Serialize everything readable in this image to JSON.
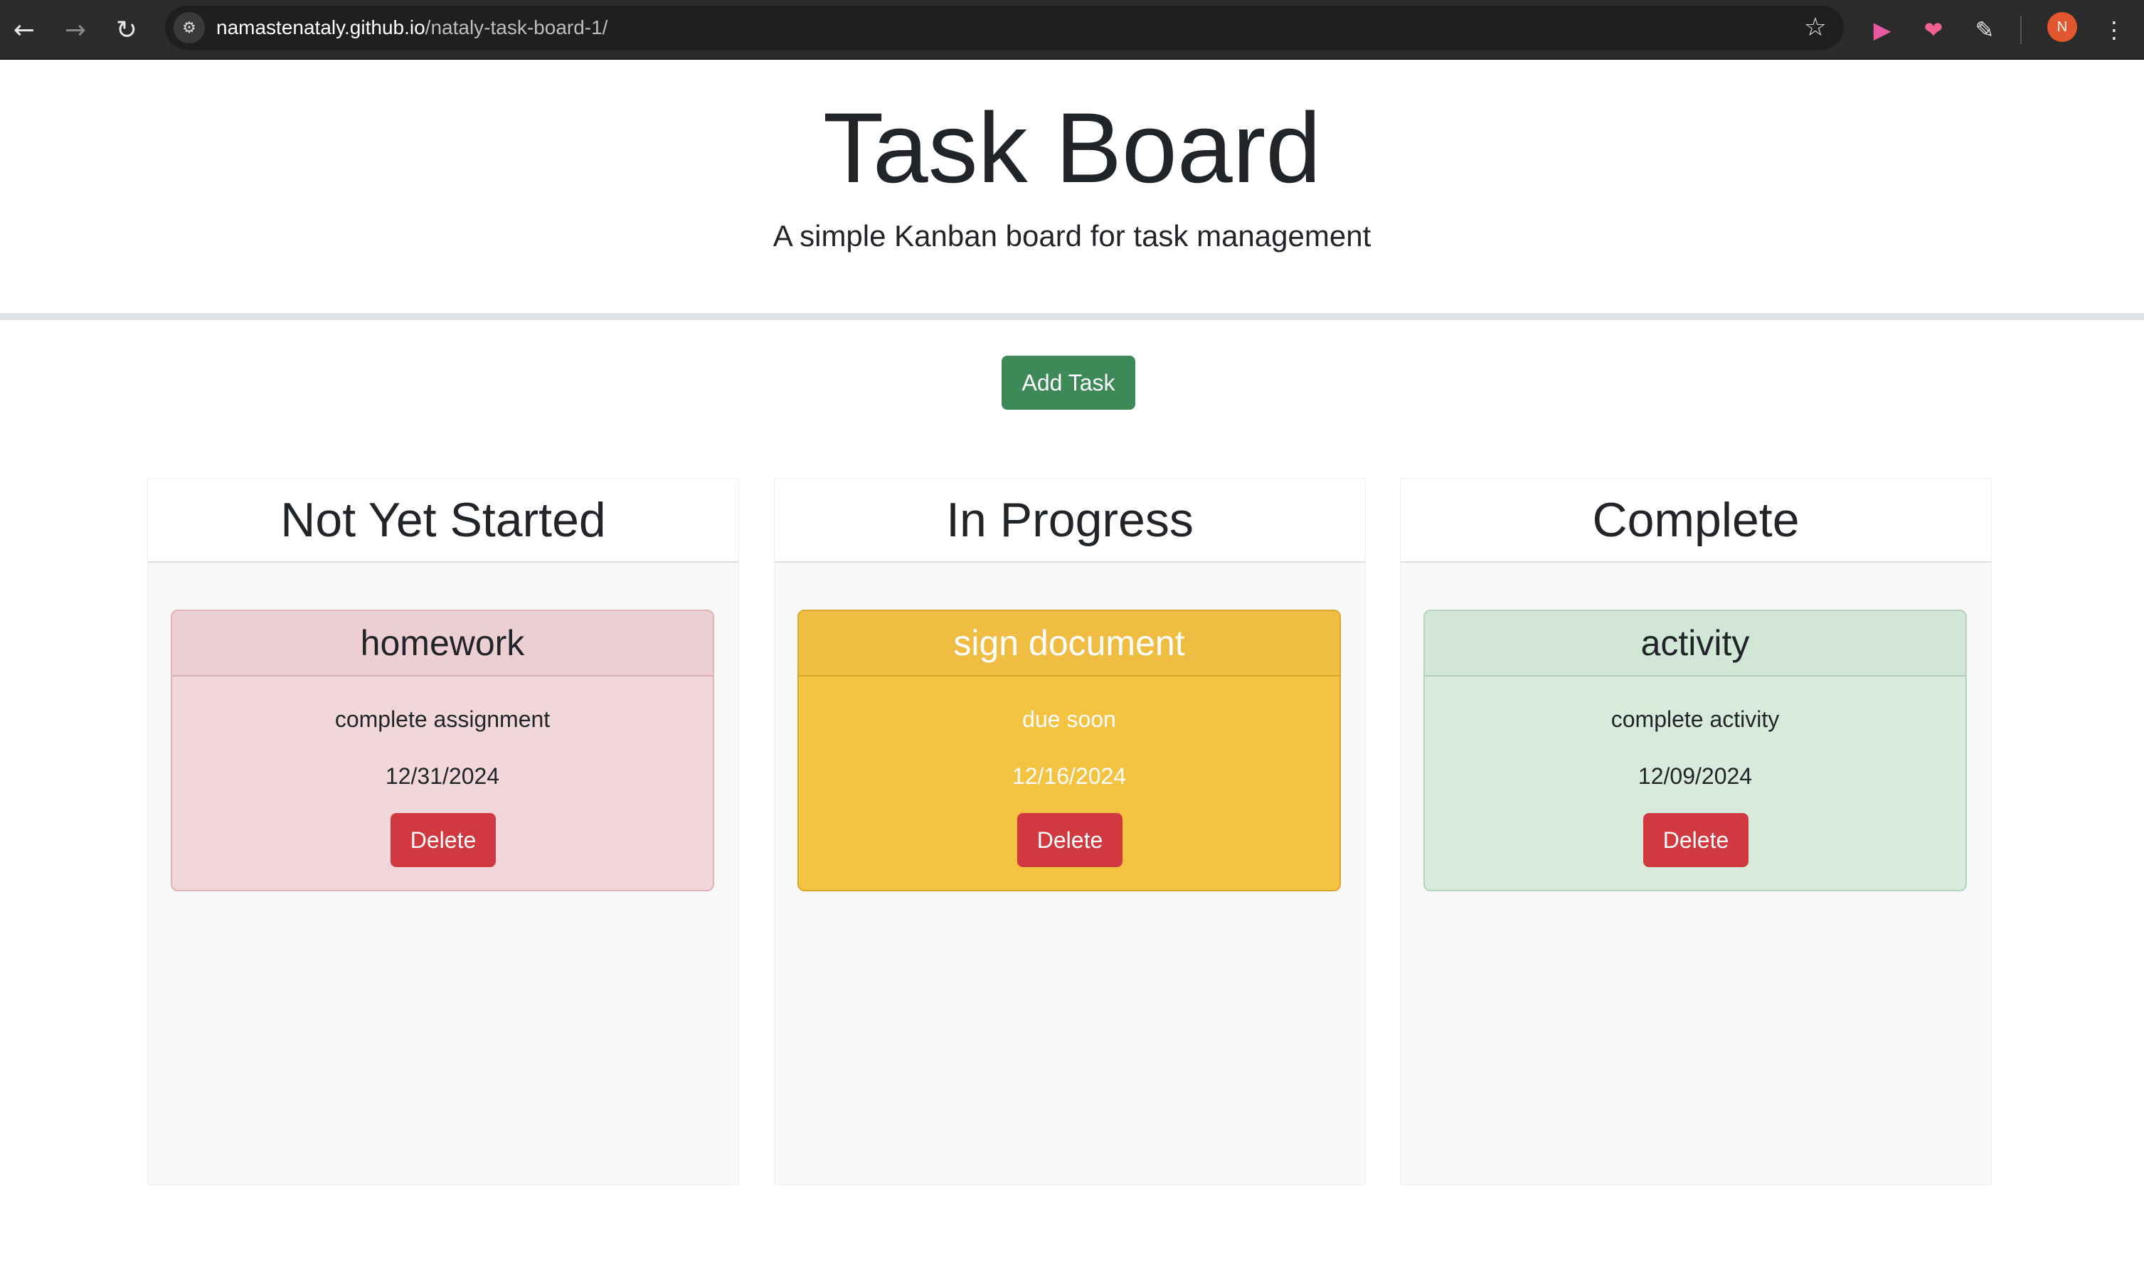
{
  "browser": {
    "url_host": "namastenataly.github.io",
    "url_path": "/nataly-task-board-1/",
    "back_icon": "arrow-left-icon",
    "forward_icon": "arrow-right-icon",
    "reload_icon": "reload-icon",
    "bookmark_icon": "star-icon",
    "profile_initial": "N"
  },
  "header": {
    "title": "Task Board",
    "subtitle": "A simple Kanban board for task management"
  },
  "actions": {
    "add_task_label": "Add Task"
  },
  "lanes": [
    {
      "title": "Not Yet Started",
      "cards": [
        {
          "title": "homework",
          "description": "complete assignment",
          "due": "12/31/2024",
          "delete_label": "Delete",
          "status_color": "#f2d7da"
        }
      ]
    },
    {
      "title": "In Progress",
      "cards": [
        {
          "title": "sign document",
          "description": "due soon",
          "due": "12/16/2024",
          "delete_label": "Delete",
          "status_color": "#f5c342"
        }
      ]
    },
    {
      "title": "Complete",
      "cards": [
        {
          "title": "activity",
          "description": "complete activity",
          "due": "12/09/2024",
          "delete_label": "Delete",
          "status_color": "#d8eadc"
        }
      ]
    }
  ],
  "colors": {
    "add_button": "#3d8a58",
    "delete_button": "#d0393f"
  }
}
